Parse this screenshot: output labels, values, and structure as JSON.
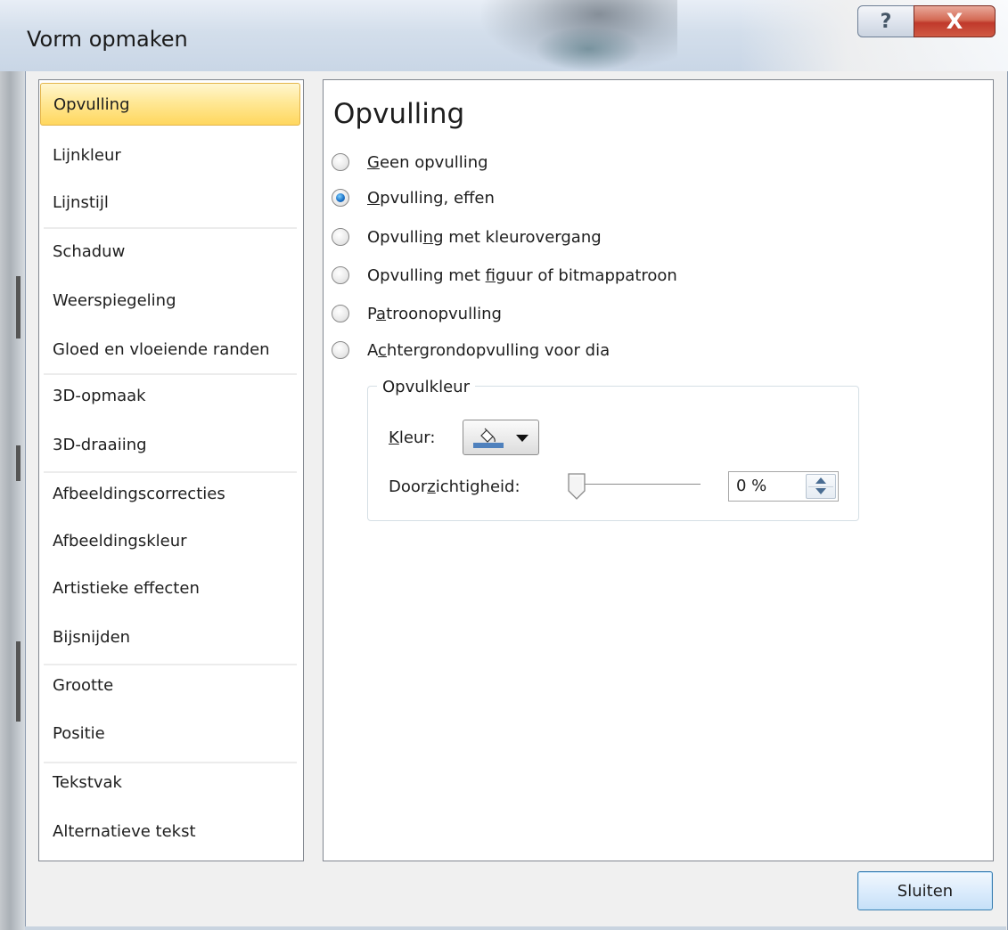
{
  "window": {
    "title": "Vorm opmaken",
    "help_glyph": "?",
    "close_glyph": "X"
  },
  "nav": {
    "items": [
      {
        "label": "Opvulling",
        "selected": true
      },
      {
        "label": "Lijnkleur"
      },
      {
        "label": "Lijnstijl"
      },
      {
        "label": "Schaduw"
      },
      {
        "label": "Weerspiegeling"
      },
      {
        "label": "Gloed en vloeiende randen"
      },
      {
        "label": "3D-opmaak"
      },
      {
        "label": "3D-draaiing"
      },
      {
        "label": "Afbeeldingscorrecties"
      },
      {
        "label": "Afbeeldingskleur"
      },
      {
        "label": "Artistieke effecten"
      },
      {
        "label": "Bijsnijden"
      },
      {
        "label": "Grootte"
      },
      {
        "label": "Positie"
      },
      {
        "label": "Tekstvak"
      },
      {
        "label": "Alternatieve tekst"
      }
    ]
  },
  "panel": {
    "title": "Opvulling",
    "fill_options": [
      {
        "pre": "",
        "key": "G",
        "post": "een opvulling",
        "checked": false
      },
      {
        "pre": "",
        "key": "O",
        "post": "pvulling, effen",
        "checked": true
      },
      {
        "pre": "Opvulli",
        "key": "n",
        "post": "g met kleurovergang",
        "checked": false
      },
      {
        "pre": "Opvulling met ",
        "key": "f",
        "post": "iguur of bitmappatroon",
        "checked": false
      },
      {
        "pre": "P",
        "key": "a",
        "post": "troonopvulling",
        "checked": false
      },
      {
        "pre": "A",
        "key": "c",
        "post": "htergrondopvulling voor dia",
        "checked": false
      }
    ],
    "fill_color_group": {
      "legend": "Opvulkleur",
      "color_label_key": "K",
      "color_label_rest": "leur:",
      "transparency_label_pre": "Door",
      "transparency_label_key": "z",
      "transparency_label_post": "ichtigheid:",
      "transparency_value": "0 %",
      "transparency_percent": 0
    }
  },
  "colors": {
    "fill_color": "#4f81bd",
    "selected_item_bg": "#ffe896"
  },
  "footer": {
    "close_label": "Sluiten"
  }
}
